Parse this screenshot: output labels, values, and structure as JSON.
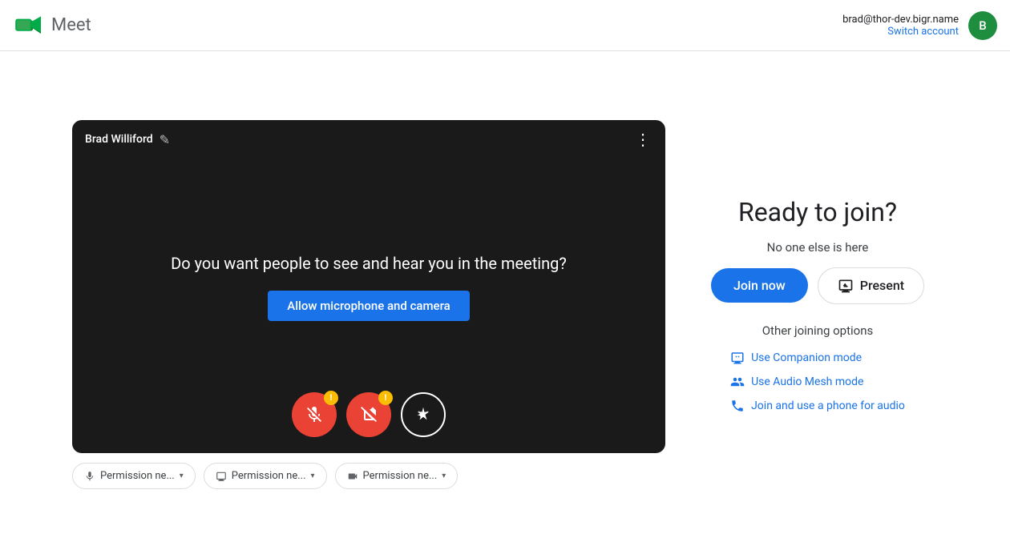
{
  "header": {
    "app_name": "Meet",
    "user_email": "brad@thor-dev.bigr.name",
    "switch_account_label": "Switch account",
    "avatar_letter": "B",
    "avatar_bg": "#1e8e3e"
  },
  "video_preview": {
    "user_name": "Brad Williford",
    "camera_prompt": "Do you want people to see and hear you in the meeting?",
    "allow_camera_label": "Allow microphone and camera"
  },
  "permissions": [
    {
      "label": "Permission ne..."
    },
    {
      "label": "Permission ne..."
    },
    {
      "label": "Permission ne..."
    }
  ],
  "join_panel": {
    "ready_title": "Ready to join?",
    "no_one_here": "No one else is here",
    "join_now_label": "Join now",
    "present_label": "Present",
    "other_options_title": "Other joining options",
    "options": [
      {
        "id": "companion",
        "label": "Use Companion mode"
      },
      {
        "id": "audio-mesh",
        "label": "Use Audio Mesh mode"
      },
      {
        "id": "phone-audio",
        "label": "Join and use a phone for audio"
      }
    ]
  }
}
